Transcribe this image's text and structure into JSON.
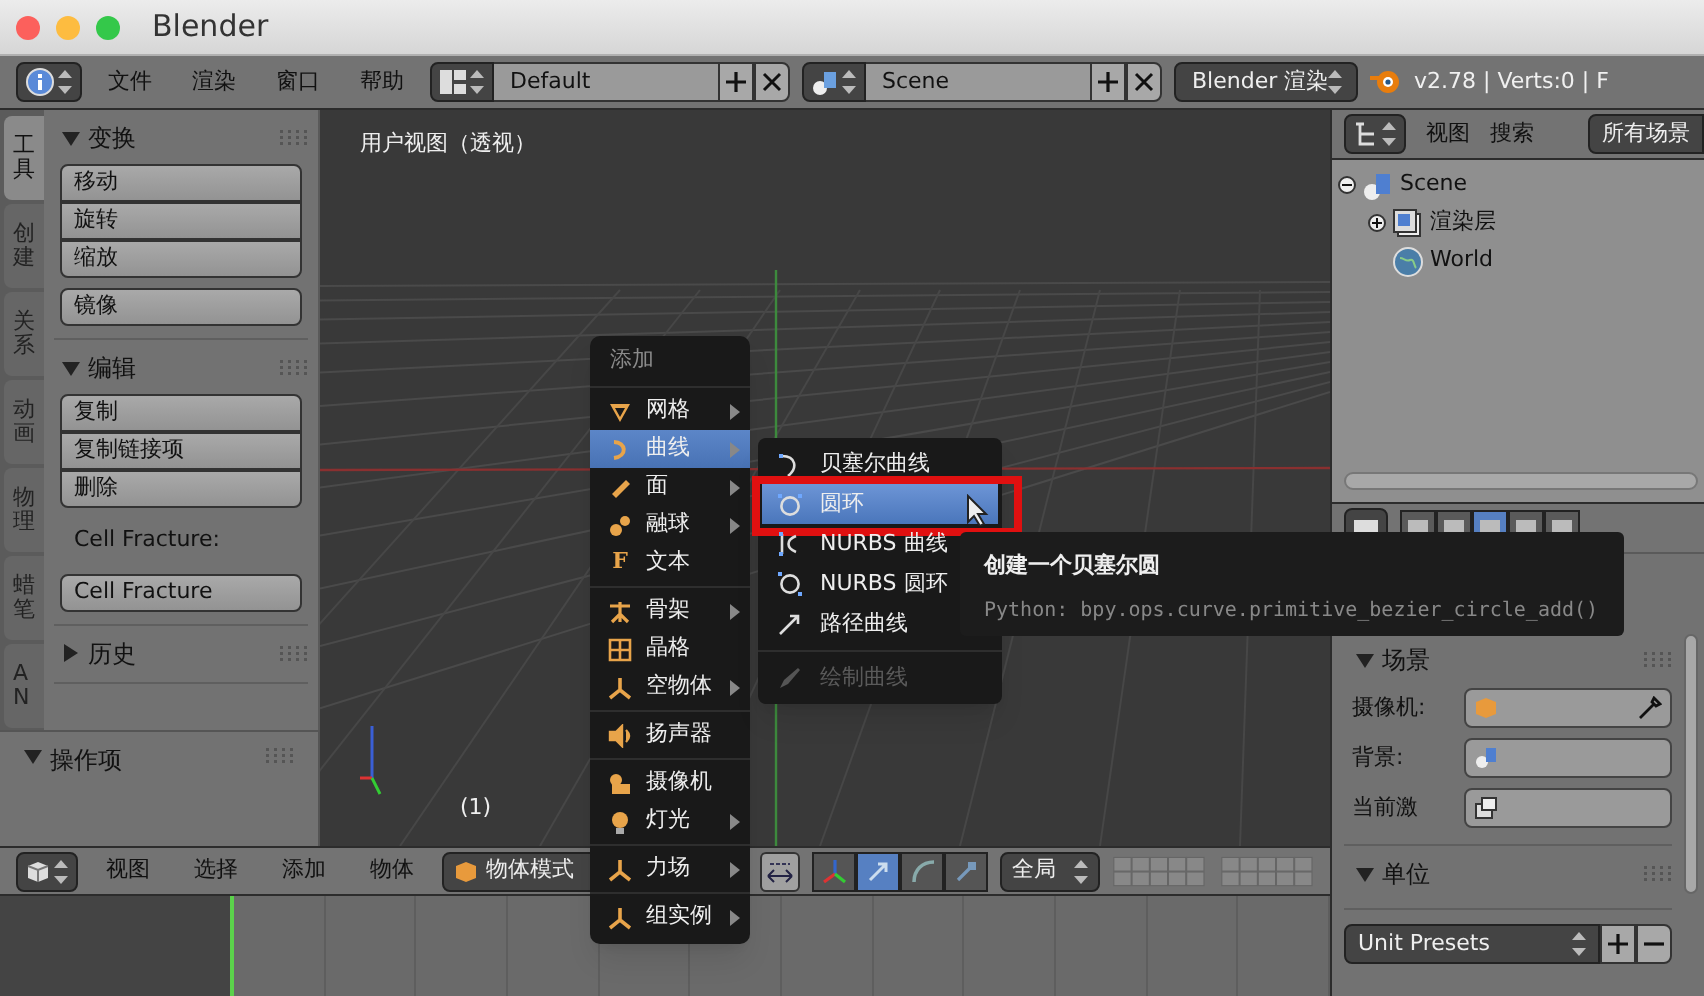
{
  "window": {
    "title": "Blender"
  },
  "info_header": {
    "menus": [
      "文件",
      "渲染",
      "窗口",
      "帮助"
    ],
    "layout": "Default",
    "scene": "Scene",
    "engine": "Blender 渲染",
    "stats": "v2.78 | Verts:0 | F"
  },
  "tool_tabs": [
    {
      "label": "工具",
      "selected": true
    },
    {
      "label": "创建",
      "selected": false
    },
    {
      "label": "关系",
      "selected": false
    },
    {
      "label": "动画",
      "selected": false
    },
    {
      "label": "物理",
      "selected": false
    },
    {
      "label": "蜡笔",
      "selected": false
    },
    {
      "label": "AN",
      "selected": false
    }
  ],
  "tool_shelf": {
    "sections": [
      {
        "title": "变换",
        "expanded": true,
        "blocks": [
          {
            "kind": "buttons",
            "labels": [
              "移动",
              "旋转",
              "缩放"
            ]
          },
          {
            "kind": "buttons",
            "labels": [
              "镜像"
            ]
          }
        ]
      },
      {
        "title": "编辑",
        "expanded": true,
        "blocks": [
          {
            "kind": "buttons",
            "labels": [
              "复制",
              "复制链接项",
              "删除"
            ]
          },
          {
            "kind": "label",
            "text": "Cell Fracture:"
          },
          {
            "kind": "buttons",
            "labels": [
              "Cell Fracture"
            ]
          }
        ]
      },
      {
        "title": "历史",
        "expanded": false
      }
    ]
  },
  "operator_panel": {
    "title": "操作项",
    "expanded": true
  },
  "viewport": {
    "title": "用户视图（透视）",
    "frame": "(1)"
  },
  "add_menu": {
    "title": "添加",
    "groups": [
      [
        {
          "label": "网格",
          "submenu": true,
          "selected": false
        },
        {
          "label": "曲线",
          "submenu": true,
          "selected": true
        },
        {
          "label": "面",
          "submenu": true,
          "selected": false
        },
        {
          "label": "融球",
          "submenu": true,
          "selected": false
        },
        {
          "label": "文本",
          "submenu": false,
          "selected": false,
          "icon_text": "F"
        }
      ],
      [
        {
          "label": "骨架",
          "submenu": true,
          "selected": false
        },
        {
          "label": "晶格",
          "submenu": false,
          "selected": false
        },
        {
          "label": "空物体",
          "submenu": true,
          "selected": false
        }
      ],
      [
        {
          "label": "扬声器",
          "submenu": false,
          "selected": false
        }
      ],
      [
        {
          "label": "摄像机",
          "submenu": false,
          "selected": false
        },
        {
          "label": "灯光",
          "submenu": true,
          "selected": false
        }
      ],
      [
        {
          "label": "力场",
          "submenu": true,
          "selected": false
        }
      ],
      [
        {
          "label": "组实例",
          "submenu": true,
          "selected": false
        }
      ]
    ]
  },
  "curve_submenu": {
    "groups": [
      [
        {
          "label": "贝塞尔曲线",
          "selected": false,
          "disabled": false,
          "annotated": false
        },
        {
          "label": "圆环",
          "selected": true,
          "disabled": false,
          "annotated": true
        },
        {
          "label": "NURBS 曲线",
          "selected": false,
          "disabled": false,
          "annotated": false
        },
        {
          "label": "NURBS 圆环",
          "selected": false,
          "disabled": false,
          "annotated": false
        },
        {
          "label": "路径曲线",
          "selected": false,
          "disabled": false,
          "annotated": false
        }
      ],
      [
        {
          "label": "绘制曲线",
          "selected": false,
          "disabled": true,
          "annotated": false
        }
      ]
    ]
  },
  "tooltip": {
    "title": "创建一个贝塞尔圆",
    "python": "Python: bpy.ops.curve.primitive_bezier_circle_add()"
  },
  "view_header": {
    "menus": [
      "视图",
      "选择",
      "添加",
      "物体"
    ],
    "mode": "物体模式",
    "orientation": "全局",
    "manipulators": [
      {
        "selected": false
      },
      {
        "selected": true
      },
      {
        "selected": false
      },
      {
        "selected": false
      }
    ]
  },
  "outliner": {
    "menus": [
      "视图",
      "搜索"
    ],
    "filter": "所有场景",
    "tree": [
      {
        "label": "Scene",
        "expanded": true,
        "children": [
          {
            "label": "渲染层",
            "expanded": false
          },
          {
            "label": "World"
          }
        ]
      }
    ]
  },
  "properties": {
    "tabs": [
      {
        "selected": false
      },
      {
        "selected": false
      },
      {
        "selected": true
      },
      {
        "selected": false
      },
      {
        "selected": false
      }
    ],
    "sections": [
      {
        "title": "场景",
        "expanded": true,
        "fields": [
          {
            "label": "摄像机:",
            "kind": "camera"
          },
          {
            "label": "背景:",
            "kind": "scene"
          },
          {
            "label": "当前激",
            "kind": "layers"
          }
        ]
      },
      {
        "title": "单位",
        "expanded": true
      }
    ],
    "unit_presets": "Unit Presets"
  }
}
